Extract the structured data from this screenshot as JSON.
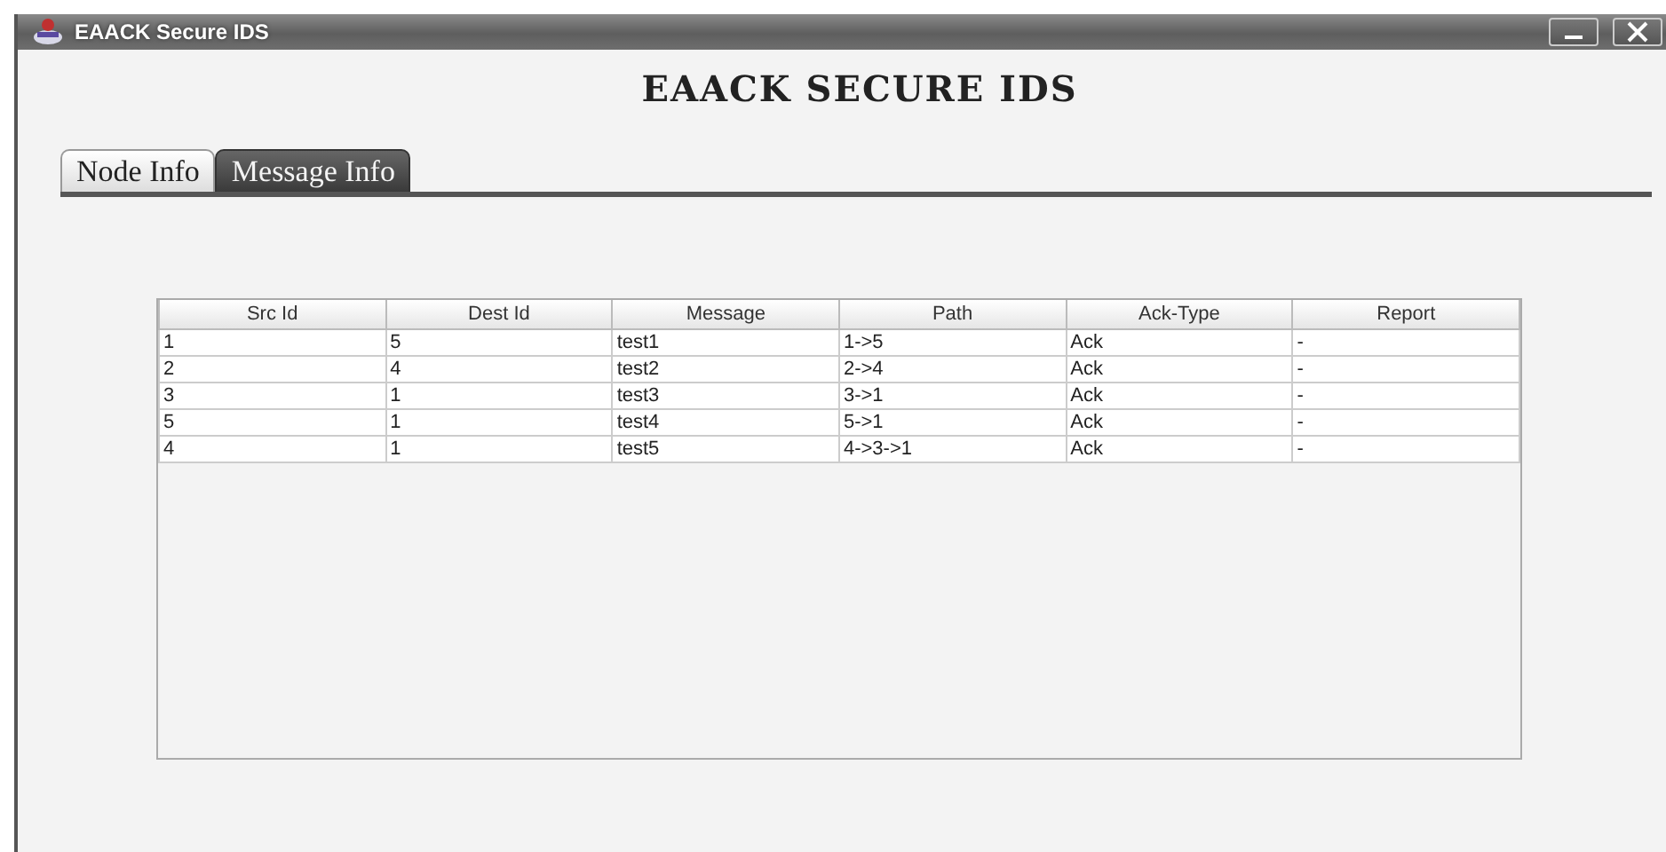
{
  "window": {
    "title": "EAACK Secure IDS"
  },
  "heading": "EAACK SECURE IDS",
  "tabs": [
    {
      "label": "Node Info",
      "selected": false
    },
    {
      "label": "Message Info",
      "selected": true
    }
  ],
  "table": {
    "columns": [
      "Src Id",
      "Dest Id",
      "Message",
      "Path",
      "Ack-Type",
      "Report"
    ],
    "rows": [
      [
        "1",
        "5",
        "test1",
        "1->5",
        "Ack",
        "-"
      ],
      [
        "2",
        "4",
        "test2",
        "2->4",
        "Ack",
        "-"
      ],
      [
        "3",
        "1",
        "test3",
        "3->1",
        "Ack",
        "-"
      ],
      [
        "5",
        "1",
        "test4",
        "5->1",
        "Ack",
        "-"
      ],
      [
        "4",
        "1",
        "test5",
        "4->3->1",
        "Ack",
        "-"
      ]
    ]
  }
}
